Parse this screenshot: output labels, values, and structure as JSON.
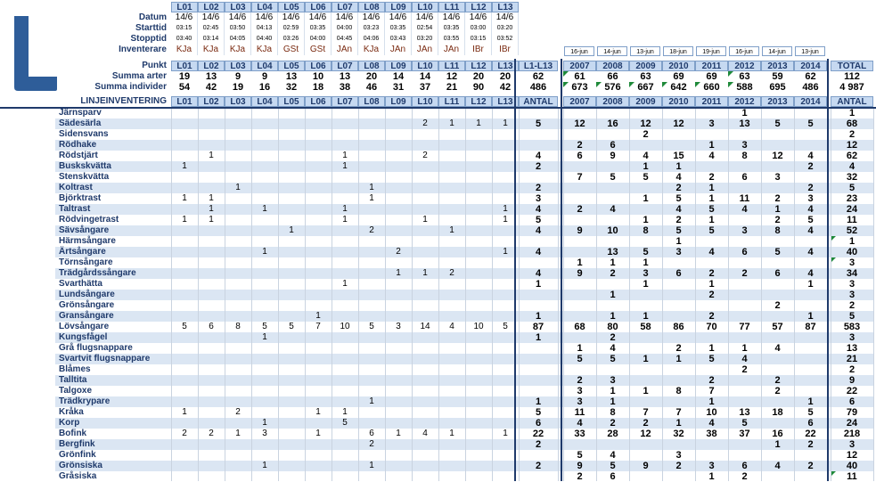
{
  "logo_letter": "L",
  "header": {
    "row_labels": [
      "Datum",
      "Starttid",
      "Stopptid",
      "Inventerare",
      "Punkt",
      "Summa arter",
      "Summa individer",
      "LINJEINVENTERING"
    ],
    "points": [
      "L01",
      "L02",
      "L03",
      "L04",
      "L05",
      "L06",
      "L07",
      "L08",
      "L09",
      "L10",
      "L11",
      "L12",
      "L13"
    ],
    "datum": [
      "14/6",
      "14/6",
      "14/6",
      "14/6",
      "14/6",
      "14/6",
      "14/6",
      "14/6",
      "14/6",
      "14/6",
      "14/6",
      "14/6",
      "14/6"
    ],
    "starttid": [
      "03:15",
      "02:45",
      "03:50",
      "04:13",
      "02:59",
      "03:35",
      "04:00",
      "03:23",
      "03:35",
      "02:54",
      "03:35",
      "03:00",
      "03:20"
    ],
    "stopptid": [
      "03:40",
      "03:14",
      "04:05",
      "04:40",
      "03:26",
      "04:00",
      "04:45",
      "04:06",
      "03:43",
      "03:20",
      "03:55",
      "03:15",
      "03:52"
    ],
    "inventerare": [
      "KJa",
      "KJa",
      "KJa",
      "KJa",
      "GSt",
      "GSt",
      "JAn",
      "KJa",
      "JAn",
      "JAn",
      "JAn",
      "IBr",
      "IBr"
    ],
    "summa_arter": [
      "19",
      "13",
      "9",
      "9",
      "13",
      "10",
      "13",
      "20",
      "14",
      "14",
      "12",
      "20",
      "20"
    ],
    "summa_individer": [
      "54",
      "42",
      "19",
      "16",
      "32",
      "18",
      "38",
      "46",
      "31",
      "37",
      "21",
      "90",
      "42"
    ],
    "sum_col_label": "L1-L13",
    "sum_arter": "62",
    "sum_individer": "486",
    "antal_label": "ANTAL",
    "years": [
      "2007",
      "2008",
      "2009",
      "2010",
      "2011",
      "2012",
      "2013",
      "2014"
    ],
    "year_dates": [
      "16-jun",
      "14-jun",
      "13-jun",
      "18-jun",
      "19-jun",
      "16-jun",
      "14-jun",
      "13-jun"
    ],
    "year_arter": [
      "61",
      "66",
      "63",
      "69",
      "69",
      "63",
      "59",
      "62"
    ],
    "year_individer": [
      "673",
      "576",
      "667",
      "642",
      "660",
      "588",
      "695",
      "486"
    ],
    "total_label": "TOTAL",
    "total_arter": "112",
    "total_individer": "4 987",
    "total_antal_label": "ANTAL"
  },
  "species": [
    {
      "name": "Järnsparv",
      "pts": [
        "",
        "",
        "",
        "",
        "",
        "",
        "",
        "",
        "",
        "",
        "",
        "",
        ""
      ],
      "sum": "",
      "years": [
        "",
        "",
        "",
        "",
        "",
        "1",
        "",
        ""
      ],
      "total": "1"
    },
    {
      "name": "Sädesärla",
      "pts": [
        "",
        "",
        "",
        "",
        "",
        "",
        "",
        "",
        "",
        "2",
        "1",
        "1",
        "1"
      ],
      "sum": "5",
      "years": [
        "12",
        "16",
        "12",
        "12",
        "3",
        "13",
        "5",
        "5"
      ],
      "total": "68"
    },
    {
      "name": "Sidensvans",
      "pts": [
        "",
        "",
        "",
        "",
        "",
        "",
        "",
        "",
        "",
        "",
        "",
        "",
        ""
      ],
      "sum": "",
      "years": [
        "",
        "",
        "2",
        "",
        "",
        "",
        "",
        ""
      ],
      "total": "2"
    },
    {
      "name": "Rödhake",
      "pts": [
        "",
        "",
        "",
        "",
        "",
        "",
        "",
        "",
        "",
        "",
        "",
        "",
        ""
      ],
      "sum": "",
      "years": [
        "2",
        "6",
        "",
        "",
        "1",
        "3",
        "",
        ""
      ],
      "total": "12"
    },
    {
      "name": "Rödstjärt",
      "pts": [
        "",
        "1",
        "",
        "",
        "",
        "",
        "1",
        "",
        "",
        "2",
        "",
        "",
        ""
      ],
      "sum": "4",
      "years": [
        "6",
        "9",
        "4",
        "15",
        "4",
        "8",
        "12",
        "4"
      ],
      "total": "62"
    },
    {
      "name": "Buskskvätta",
      "pts": [
        "1",
        "",
        "",
        "",
        "",
        "",
        "1",
        "",
        "",
        "",
        "",
        "",
        ""
      ],
      "sum": "2",
      "years": [
        "",
        "",
        "1",
        "1",
        "",
        "",
        "",
        "2"
      ],
      "total": "4"
    },
    {
      "name": "Stenskvätta",
      "pts": [
        "",
        "",
        "",
        "",
        "",
        "",
        "",
        "",
        "",
        "",
        "",
        "",
        ""
      ],
      "sum": "",
      "years": [
        "7",
        "5",
        "5",
        "4",
        "2",
        "6",
        "3",
        ""
      ],
      "total": "32"
    },
    {
      "name": "Koltrast",
      "pts": [
        "",
        "",
        "1",
        "",
        "",
        "",
        "",
        "1",
        "",
        "",
        "",
        "",
        ""
      ],
      "sum": "2",
      "years": [
        "",
        "",
        "",
        "2",
        "1",
        "",
        "",
        "2"
      ],
      "total": "5"
    },
    {
      "name": "Björktrast",
      "pts": [
        "1",
        "1",
        "",
        "",
        "",
        "",
        "",
        "1",
        "",
        "",
        "",
        "",
        ""
      ],
      "sum": "3",
      "years": [
        "",
        "",
        "1",
        "5",
        "1",
        "11",
        "2",
        "3"
      ],
      "total": "23"
    },
    {
      "name": "Taltrast",
      "pts": [
        "",
        "1",
        "",
        "1",
        "",
        "",
        "1",
        "",
        "",
        "",
        "",
        "",
        "1"
      ],
      "sum": "4",
      "years": [
        "2",
        "4",
        "",
        "4",
        "5",
        "4",
        "1",
        "4"
      ],
      "total": "24"
    },
    {
      "name": "Rödvingetrast",
      "pts": [
        "1",
        "1",
        "",
        "",
        "",
        "",
        "1",
        "",
        "",
        "1",
        "",
        "",
        "1"
      ],
      "sum": "5",
      "years": [
        "",
        "",
        "1",
        "2",
        "1",
        "",
        "2",
        "5"
      ],
      "total": "11"
    },
    {
      "name": "Sävsångare",
      "pts": [
        "",
        "",
        "",
        "",
        "1",
        "",
        "",
        "2",
        "",
        "",
        "1",
        "",
        ""
      ],
      "sum": "4",
      "years": [
        "9",
        "10",
        "8",
        "5",
        "5",
        "3",
        "8",
        "4"
      ],
      "total": "52"
    },
    {
      "name": "Härmsångare",
      "pts": [
        "",
        "",
        "",
        "",
        "",
        "",
        "",
        "",
        "",
        "",
        "",
        "",
        ""
      ],
      "sum": "",
      "years": [
        "",
        "",
        "",
        "1",
        "",
        "",
        "",
        ""
      ],
      "total": "1"
    },
    {
      "name": "Ärtsångare",
      "pts": [
        "",
        "",
        "",
        "1",
        "",
        "",
        "",
        "",
        "2",
        "",
        "",
        "",
        "1"
      ],
      "sum": "4",
      "years": [
        "",
        "13",
        "5",
        "3",
        "4",
        "6",
        "5",
        "4"
      ],
      "total": "40"
    },
    {
      "name": "Törnsångare",
      "pts": [
        "",
        "",
        "",
        "",
        "",
        "",
        "",
        "",
        "",
        "",
        "",
        "",
        ""
      ],
      "sum": "",
      "years": [
        "1",
        "1",
        "1",
        "",
        "",
        "",
        "",
        ""
      ],
      "total": "3"
    },
    {
      "name": "Trädgårdssångare",
      "pts": [
        "",
        "",
        "",
        "",
        "",
        "",
        "",
        "",
        "1",
        "1",
        "2",
        "",
        ""
      ],
      "sum": "4",
      "years": [
        "9",
        "2",
        "3",
        "6",
        "2",
        "2",
        "6",
        "4"
      ],
      "total": "34"
    },
    {
      "name": "Svarthätta",
      "pts": [
        "",
        "",
        "",
        "",
        "",
        "",
        "1",
        "",
        "",
        "",
        "",
        "",
        ""
      ],
      "sum": "1",
      "years": [
        "",
        "",
        "1",
        "",
        "1",
        "",
        "",
        "1"
      ],
      "total": "3"
    },
    {
      "name": "Lundsångare",
      "pts": [
        "",
        "",
        "",
        "",
        "",
        "",
        "",
        "",
        "",
        "",
        "",
        "",
        ""
      ],
      "sum": "",
      "years": [
        "",
        "1",
        "",
        "",
        "2",
        "",
        "",
        ""
      ],
      "total": "3"
    },
    {
      "name": "Grönsångare",
      "pts": [
        "",
        "",
        "",
        "",
        "",
        "",
        "",
        "",
        "",
        "",
        "",
        "",
        ""
      ],
      "sum": "",
      "years": [
        "",
        "",
        "",
        "",
        "",
        "",
        "2",
        ""
      ],
      "total": "2"
    },
    {
      "name": "Gransångare",
      "pts": [
        "",
        "",
        "",
        "",
        "",
        "1",
        "",
        "",
        "",
        "",
        "",
        "",
        ""
      ],
      "sum": "1",
      "years": [
        "",
        "1",
        "1",
        "",
        "2",
        "",
        "",
        "1"
      ],
      "total": "5"
    },
    {
      "name": "Lövsångare",
      "pts": [
        "5",
        "6",
        "8",
        "5",
        "5",
        "7",
        "10",
        "5",
        "3",
        "14",
        "4",
        "10",
        "5"
      ],
      "sum": "87",
      "years": [
        "68",
        "80",
        "58",
        "86",
        "70",
        "77",
        "57",
        "87"
      ],
      "total": "583"
    },
    {
      "name": "Kungsfågel",
      "pts": [
        "",
        "",
        "",
        "1",
        "",
        "",
        "",
        "",
        "",
        "",
        "",
        "",
        ""
      ],
      "sum": "1",
      "years": [
        "",
        "2",
        "",
        "",
        "",
        "",
        "",
        ""
      ],
      "total": "3"
    },
    {
      "name": "Grå flugsnappare",
      "pts": [
        "",
        "",
        "",
        "",
        "",
        "",
        "",
        "",
        "",
        "",
        "",
        "",
        ""
      ],
      "sum": "",
      "years": [
        "1",
        "4",
        "",
        "2",
        "1",
        "1",
        "4",
        ""
      ],
      "total": "13"
    },
    {
      "name": "Svartvit flugsnappare",
      "pts": [
        "",
        "",
        "",
        "",
        "",
        "",
        "",
        "",
        "",
        "",
        "",
        "",
        ""
      ],
      "sum": "",
      "years": [
        "5",
        "5",
        "1",
        "1",
        "5",
        "4",
        "",
        ""
      ],
      "total": "21"
    },
    {
      "name": "Blåmes",
      "pts": [
        "",
        "",
        "",
        "",
        "",
        "",
        "",
        "",
        "",
        "",
        "",
        "",
        ""
      ],
      "sum": "",
      "years": [
        "",
        "",
        "",
        "",
        "",
        "2",
        "",
        ""
      ],
      "total": "2"
    },
    {
      "name": "Talltita",
      "pts": [
        "",
        "",
        "",
        "",
        "",
        "",
        "",
        "",
        "",
        "",
        "",
        "",
        ""
      ],
      "sum": "",
      "years": [
        "2",
        "3",
        "",
        "",
        "2",
        "",
        "2",
        ""
      ],
      "total": "9"
    },
    {
      "name": "Talgoxe",
      "pts": [
        "",
        "",
        "",
        "",
        "",
        "",
        "",
        "",
        "",
        "",
        "",
        "",
        ""
      ],
      "sum": "",
      "years": [
        "3",
        "1",
        "1",
        "8",
        "7",
        "",
        "2",
        ""
      ],
      "total": "22"
    },
    {
      "name": "Trädkrypare",
      "pts": [
        "",
        "",
        "",
        "",
        "",
        "",
        "",
        "1",
        "",
        "",
        "",
        "",
        ""
      ],
      "sum": "1",
      "years": [
        "3",
        "1",
        "",
        "",
        "1",
        "",
        "",
        "1"
      ],
      "total": "6"
    },
    {
      "name": "Kråka",
      "pts": [
        "1",
        "",
        "2",
        "",
        "",
        "1",
        "1",
        "",
        "",
        "",
        "",
        "",
        ""
      ],
      "sum": "5",
      "years": [
        "11",
        "8",
        "7",
        "7",
        "10",
        "13",
        "18",
        "5"
      ],
      "total": "79"
    },
    {
      "name": "Korp",
      "pts": [
        "",
        "",
        "",
        "1",
        "",
        "",
        "5",
        "",
        "",
        "",
        "",
        "",
        ""
      ],
      "sum": "6",
      "years": [
        "4",
        "2",
        "2",
        "1",
        "4",
        "5",
        "",
        "6"
      ],
      "total": "24"
    },
    {
      "name": "Bofink",
      "pts": [
        "2",
        "2",
        "1",
        "3",
        "",
        "1",
        "",
        "6",
        "1",
        "4",
        "1",
        "",
        "1"
      ],
      "sum": "22",
      "years": [
        "33",
        "28",
        "12",
        "32",
        "38",
        "37",
        "16",
        "22"
      ],
      "total": "218"
    },
    {
      "name": "Bergfink",
      "pts": [
        "",
        "",
        "",
        "",
        "",
        "",
        "",
        "2",
        "",
        "",
        "",
        "",
        ""
      ],
      "sum": "2",
      "years": [
        "",
        "",
        "",
        "",
        "",
        "",
        "1",
        "2"
      ],
      "total": "3"
    },
    {
      "name": "Grönfink",
      "pts": [
        "",
        "",
        "",
        "",
        "",
        "",
        "",
        "",
        "",
        "",
        "",
        "",
        ""
      ],
      "sum": "",
      "years": [
        "5",
        "4",
        "",
        "3",
        "",
        "",
        "",
        ""
      ],
      "total": "12"
    },
    {
      "name": "Grönsiska",
      "pts": [
        "",
        "",
        "",
        "1",
        "",
        "",
        "",
        "1",
        "",
        "",
        "",
        "",
        ""
      ],
      "sum": "2",
      "years": [
        "9",
        "5",
        "9",
        "2",
        "3",
        "6",
        "4",
        "2"
      ],
      "total": "40"
    },
    {
      "name": "Gråsiska",
      "pts": [
        "",
        "",
        "",
        "",
        "",
        "",
        "",
        "",
        "",
        "",
        "",
        "",
        ""
      ],
      "sum": "",
      "years": [
        "2",
        "6",
        "",
        "",
        "1",
        "2",
        "",
        ""
      ],
      "total": "11"
    }
  ],
  "colors": {
    "header_fill": "#c6d9f1",
    "header_text": "#1f3a6b",
    "band_fill": "#dbe6f3",
    "logo": "#2e5d99",
    "comment_marker": "#1f8a3a"
  }
}
